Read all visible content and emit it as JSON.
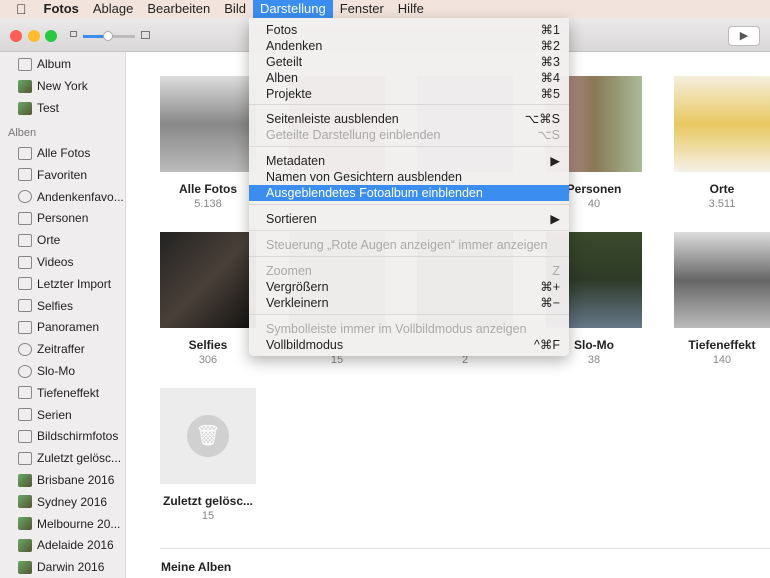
{
  "menubar": {
    "apple": "",
    "items": [
      "Fotos",
      "Ablage",
      "Bearbeiten",
      "Bild",
      "Darstellung",
      "Fenster",
      "Hilfe"
    ]
  },
  "toolbar": {
    "play": "▶"
  },
  "sidebar": {
    "top": [
      {
        "label": "Album",
        "icon": "album-icon"
      },
      {
        "label": "New York",
        "icon": "photo-icon"
      },
      {
        "label": "Test",
        "icon": "photo-icon"
      }
    ],
    "section": "Alben",
    "items": [
      {
        "label": "Alle Fotos"
      },
      {
        "label": "Favoriten"
      },
      {
        "label": "Andenkenfavo..."
      },
      {
        "label": "Personen"
      },
      {
        "label": "Orte"
      },
      {
        "label": "Videos"
      },
      {
        "label": "Letzter Import"
      },
      {
        "label": "Selfies"
      },
      {
        "label": "Panoramen"
      },
      {
        "label": "Zeitraffer"
      },
      {
        "label": "Slo-Mo"
      },
      {
        "label": "Tiefeneffekt"
      },
      {
        "label": "Serien"
      },
      {
        "label": "Bildschirmfotos"
      },
      {
        "label": "Zuletzt gelösc..."
      },
      {
        "label": "Brisbane 2016"
      },
      {
        "label": "Sydney 2016"
      },
      {
        "label": "Melbourne 20..."
      },
      {
        "label": "Adelaide 2016"
      },
      {
        "label": "Darwin 2016"
      }
    ]
  },
  "grid": [
    {
      "label": "Alle Fotos",
      "count": "5.138"
    },
    {
      "label": "",
      "count": ""
    },
    {
      "label": "",
      "count": ""
    },
    {
      "label": "Personen",
      "count": "40"
    },
    {
      "label": "Orte",
      "count": "3.511"
    },
    {
      "label": "Selfies",
      "count": "306"
    },
    {
      "label": "",
      "count": "15"
    },
    {
      "label": "",
      "count": "2"
    },
    {
      "label": "Slo-Mo",
      "count": "38"
    },
    {
      "label": "Tiefeneffekt",
      "count": "140"
    },
    {
      "label": "Zuletzt gelösc...",
      "count": "15"
    }
  ],
  "section_title": "Meine Alben",
  "menu": [
    {
      "label": "Fotos",
      "sc": "⌘1"
    },
    {
      "label": "Andenken",
      "sc": "⌘2"
    },
    {
      "label": "Geteilt",
      "sc": "⌘3"
    },
    {
      "label": "Alben",
      "sc": "⌘4"
    },
    {
      "label": "Projekte",
      "sc": "⌘5"
    },
    {
      "label": "Seitenleiste ausblenden",
      "sc": "⌥⌘S"
    },
    {
      "label": "Geteilte Darstellung einblenden",
      "sc": "⌥S"
    },
    {
      "label": "Metadaten",
      "sc": "▶"
    },
    {
      "label": "Namen von Gesichtern ausblenden",
      "sc": ""
    },
    {
      "label": "Ausgeblendetes Fotoalbum einblenden",
      "sc": ""
    },
    {
      "label": "Sortieren",
      "sc": "▶"
    },
    {
      "label": "Steuerung „Rote Augen anzeigen“ immer anzeigen",
      "sc": ""
    },
    {
      "label": "Zoomen",
      "sc": "Z"
    },
    {
      "label": "Vergrößern",
      "sc": "⌘+"
    },
    {
      "label": "Verkleinern",
      "sc": "⌘−"
    },
    {
      "label": "Symbolleiste immer im Vollbildmodus anzeigen",
      "sc": ""
    },
    {
      "label": "Vollbildmodus",
      "sc": "^⌘F"
    }
  ]
}
